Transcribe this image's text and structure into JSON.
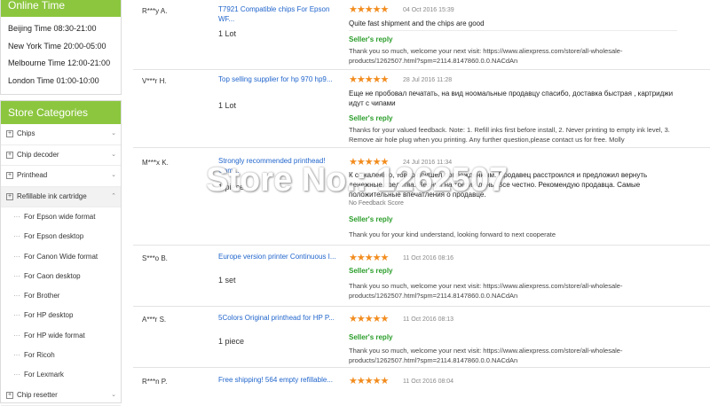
{
  "online_time": {
    "title": "Online Time",
    "rows": [
      "Beijing Time 08:30-21:00",
      "New York Time 20:00-05:00",
      "Melbourne Time 12:00-21:00",
      "London Time 01:00-10:00"
    ]
  },
  "categories": {
    "title": "Store Categories",
    "items": [
      "Chips",
      "Chip decoder",
      "Printhead",
      "Refillable ink cartridge"
    ],
    "subitems": [
      "For Epson wide format",
      "For Epson desktop",
      "For Canon Wide format",
      "For Caon desktop",
      "For Brother",
      "For HP desktop",
      "For HP wide format",
      "For Ricoh",
      "For Lexmark"
    ],
    "last_item": "Chip resetter"
  },
  "feedback": [
    {
      "buyer": "R***y A.",
      "product": "T7921 Compatible chips For Epson WF...",
      "qty": "1 Lot",
      "stars": "★★★★★",
      "date": "04 Oct 2016 15:39",
      "comment": "Quite fast shipment and the chips are good",
      "reply_label": "Seller's reply",
      "reply": "Thank you so much, welcome your next visit: https://www.aliexpress.com/store/all-wholesale-products/1262507.html?spm=2114.8147860.0.0.NACdAn"
    },
    {
      "buyer": "V***r H.",
      "product": "Top selling supplier for hp 970 hp9...",
      "qty": "1 Lot",
      "stars": "★★★★★",
      "date": "28 Jul 2016 11:28",
      "comment": "Еще не пробовал печатать, на вид ноомальные продавцу спасибо, доставка быстрая , картриджи идут с чипами",
      "reply_label": "Seller's reply",
      "reply": "Thanks for your valued feedback. Note: 1. Refill inks first before install, 2. Never printing to empty ink level, 3. Remove air hole plug when you printing. Any further question,please contact us for free. Molly"
    },
    {
      "buyer": "M***x K.",
      "product": "Strongly recommended printhead! Com...",
      "qty": "1 piece",
      "stars": "★★★★★",
      "date": "24 Jul 2016 11:34",
      "comment": "К сожалению, товар пришел поврежденным. Продавец расстроился и предложил вернуть денежные средства. Вернул на третий день. Все честно. Рекомендую продавца. Самые положительные впечатления о продавце.",
      "no_feedback": "No Feedback Score",
      "reply_label": "Seller's reply",
      "reply": "Thank you for your kind understand, looking forward to next cooperate"
    },
    {
      "buyer": "S***o B.",
      "product": "Europe version printer Continuous I...",
      "qty": "1 set",
      "stars": "★★★★★",
      "date": "11 Oct 2016 08:16",
      "reply_label": "Seller's reply",
      "reply": "Thank you so much, welcome your next visit: https://www.aliexpress.com/store/all-wholesale-products/1262507.html?spm=2114.8147860.0.0.NACdAn"
    },
    {
      "buyer": "A***r S.",
      "product": "5Colors Original printhead for HP P...",
      "qty": "1 piece",
      "stars": "★★★★★",
      "date": "11 Oct 2016 08:13",
      "reply_label": "Seller's reply",
      "reply": "Thank you so much, welcome your next visit: https://www.aliexpress.com/store/all-wholesale-products/1262507.html?spm=2114.8147860.0.0.NACdAn"
    },
    {
      "buyer": "R***n P.",
      "product": "Free shipping! 564 empty refillable...",
      "stars": "★★★★★",
      "date": "11 Oct 2016 08:04"
    }
  ],
  "watermark": "Store No.: 1262507",
  "colors": {
    "accent": "#8cc63f",
    "link": "#2266cc",
    "reply_green": "#2a9d2a",
    "star": "#f28c1e"
  }
}
